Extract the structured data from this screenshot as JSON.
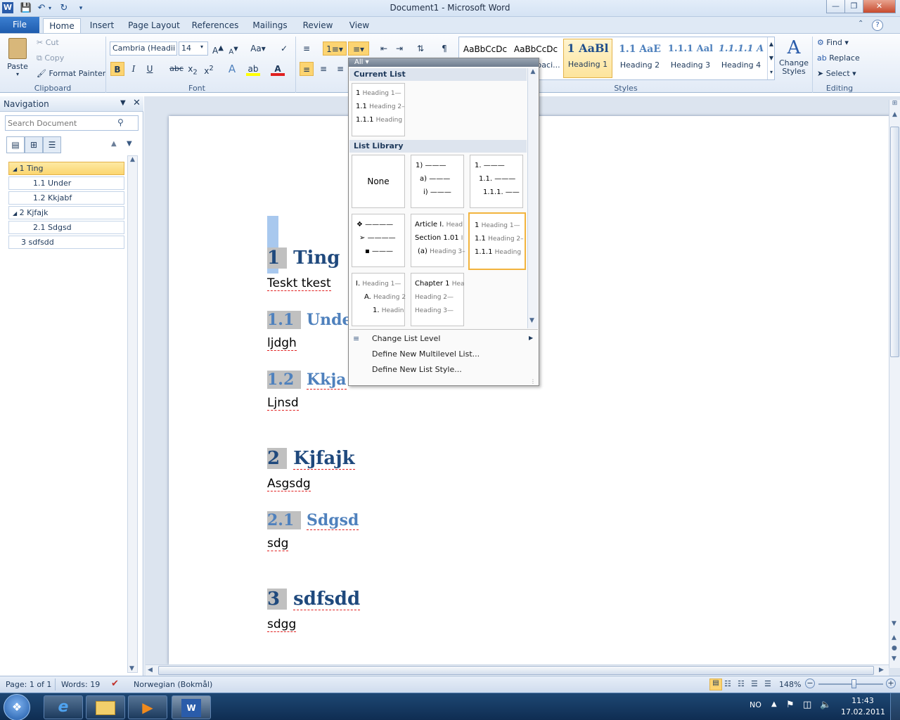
{
  "window": {
    "title": "Document1 - Microsoft Word",
    "app_icon": "W"
  },
  "tabs": [
    "File",
    "Home",
    "Insert",
    "Page Layout",
    "References",
    "Mailings",
    "Review",
    "View"
  ],
  "clipboard": {
    "paste": "Paste",
    "cut": "Cut",
    "copy": "Copy",
    "format_painter": "Format Painter",
    "label": "Clipboard"
  },
  "font": {
    "name": "Cambria (Headii",
    "size": "14",
    "label": "Font"
  },
  "paragraph": {
    "label": ""
  },
  "styles": {
    "label": "Styles",
    "items": [
      {
        "preview": "AaBbCcDc",
        "name": ""
      },
      {
        "preview": "AaBbCcDc",
        "name": "¶ No Spaci..."
      },
      {
        "preview": "1 AaBl",
        "name": "Heading 1"
      },
      {
        "preview": "1.1 AaE",
        "name": "Heading 2"
      },
      {
        "preview": "1.1.1 Aal",
        "name": "Heading 3"
      },
      {
        "preview": "1.1.1.1 A",
        "name": "Heading 4"
      }
    ],
    "change_styles": "Change Styles"
  },
  "editing": {
    "find": "Find",
    "replace": "Replace",
    "select": "Select",
    "label": "Editing"
  },
  "navigation": {
    "title": "Navigation",
    "search_placeholder": "Search Document",
    "items": [
      {
        "text": "1 Ting"
      },
      {
        "text": "1.1 Under"
      },
      {
        "text": "1.2 Kkjabf"
      },
      {
        "text": "2 Kjfajk"
      },
      {
        "text": "2.1 Sdgsd"
      },
      {
        "text": "3 sdfsdd"
      }
    ]
  },
  "document": {
    "sections": [
      {
        "num": "1",
        "title": "Ting",
        "body": "Teskt tkest"
      },
      {
        "num": "1.1",
        "title": "Unde",
        "body": "ljdgh"
      },
      {
        "num": "1.2",
        "title": "Kkja",
        "body": "Ljnsd"
      },
      {
        "num": "2",
        "title": "Kjfajk",
        "body": "Asgsdg"
      },
      {
        "num": "2.1",
        "title": "Sdgsd",
        "body": "sdg"
      },
      {
        "num": "3",
        "title": "sdfsdd",
        "body": "sdgg"
      }
    ]
  },
  "dropdown": {
    "filter": "All",
    "current_list_label": "Current List",
    "list_library_label": "List Library",
    "current": {
      "l1": "1",
      "l1s": "Heading 1—",
      "l2": "1.1",
      "l2s": "Heading 2–",
      "l3": "1.1.1",
      "l3s": "Heading"
    },
    "none_label": "None",
    "lib_paren": {
      "l1": "1)",
      "l2": "a)",
      "l3": "i)"
    },
    "lib_decimal": {
      "l1": "1.",
      "l2": "1.1.",
      "l3": "1.1.1."
    },
    "lib_bullets": {
      "l1": "❖",
      "l2": "➢",
      "l3": "▪"
    },
    "lib_article": {
      "l1": "Article I.",
      "l1s": "Head",
      "l2": "Section 1.01",
      "l2s": "I",
      "l3": "(a)",
      "l3s": "Heading 3–"
    },
    "lib_heading": {
      "l1": "1",
      "l1s": "Heading 1—",
      "l2": "1.1",
      "l2s": "Heading 2–",
      "l3": "1.1.1",
      "l3s": "Heading"
    },
    "lib_roman": {
      "l1": "I.",
      "l1s": "Heading 1—",
      "l2": "A.",
      "l2s": "Heading 2",
      "l3": "1.",
      "l3s": "Headin"
    },
    "lib_chapter": {
      "l1": "Chapter 1",
      "l1s": "Hea",
      "l2": "Heading 2—",
      "l3": "Heading 3—"
    },
    "menu": [
      "Change List Level",
      "Define New Multilevel List...",
      "Define New List Style..."
    ]
  },
  "status": {
    "page": "Page: 1 of 1",
    "words": "Words: 19",
    "language": "Norwegian (Bokmål)",
    "zoom": "148%"
  },
  "taskbar": {
    "lang": "NO",
    "time": "11:43",
    "date": "17.02.2011"
  }
}
